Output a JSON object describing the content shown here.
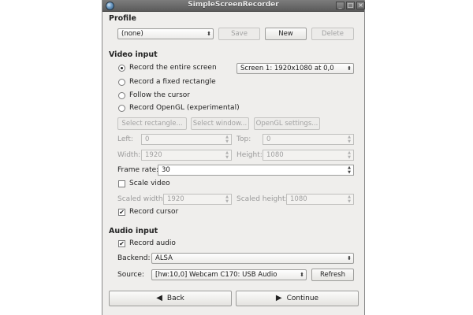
{
  "window": {
    "title": "SimpleScreenRecorder"
  },
  "profile": {
    "section_title": "Profile",
    "selected": "(none)",
    "save_label": "Save",
    "new_label": "New",
    "delete_label": "Delete"
  },
  "video_input": {
    "section_title": "Video input",
    "options": [
      {
        "label": "Record the entire screen",
        "selected": true
      },
      {
        "label": "Record a fixed rectangle",
        "selected": false
      },
      {
        "label": "Follow the cursor",
        "selected": false
      },
      {
        "label": "Record OpenGL (experimental)",
        "selected": false
      }
    ],
    "screen_select": "Screen 1: 1920x1080 at 0,0",
    "select_rectangle_label": "Select rectangle...",
    "select_window_label": "Select window...",
    "opengl_settings_label": "OpenGL settings...",
    "left_label": "Left:",
    "left_value": "0",
    "top_label": "Top:",
    "top_value": "0",
    "width_label": "Width:",
    "width_value": "1920",
    "height_label": "Height:",
    "height_value": "1080",
    "frame_rate_label": "Frame rate:",
    "frame_rate_value": "30",
    "scale_video_label": "Scale video",
    "scale_video_checked": false,
    "scaled_width_label": "Scaled width:",
    "scaled_width_value": "1920",
    "scaled_height_label": "Scaled height:",
    "scaled_height_value": "1080",
    "record_cursor_label": "Record cursor",
    "record_cursor_checked": true
  },
  "audio_input": {
    "section_title": "Audio input",
    "record_audio_label": "Record audio",
    "record_audio_checked": true,
    "backend_label": "Backend:",
    "backend_value": "ALSA",
    "source_label": "Source:",
    "source_value": "[hw:10,0] Webcam C170: USB Audio",
    "refresh_label": "Refresh"
  },
  "navigation": {
    "back_label": "Back",
    "continue_label": "Continue"
  },
  "icons": {
    "check_mark": "✔",
    "combo_arrow": "⬍",
    "back_arrow": "◀",
    "continue_arrow": "▶"
  }
}
